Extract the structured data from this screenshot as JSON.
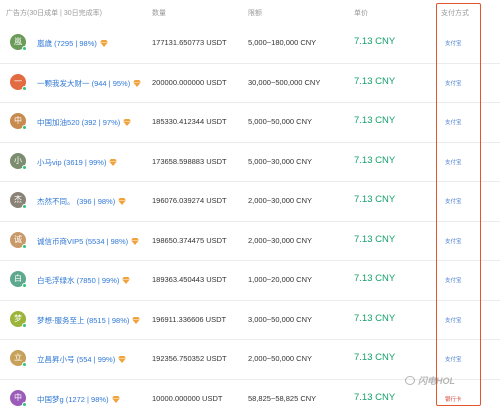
{
  "header": {
    "advertiser": "广告方(30日成单 | 30日完成率)",
    "quantity": "数量",
    "limit": "限额",
    "price": "单价",
    "payment": "支付方式"
  },
  "rows": [
    {
      "avatar": "嵐",
      "avatar_color": "#6b9b59",
      "name": "嵐歳 (7295 | 98%)",
      "qty": "177131.650773 USDT",
      "limit": "5,000~180,000 CNY",
      "price": "7.13 CNY",
      "pay": "支付宝"
    },
    {
      "avatar": "一",
      "avatar_color": "#e26b42",
      "name": "一颗我发大财一 (944 | 95%)",
      "qty": "200000.000000 USDT",
      "limit": "30,000~500,000 CNY",
      "price": "7.13 CNY",
      "pay": "支付宝"
    },
    {
      "avatar": "中",
      "avatar_color": "#c78a4f",
      "name": "中国加油520 (392 | 97%)",
      "qty": "185330.412344 USDT",
      "limit": "5,000~50,000 CNY",
      "price": "7.13 CNY",
      "pay": "支付宝"
    },
    {
      "avatar": "小",
      "avatar_color": "#7c8c6e",
      "name": "小马vip (3619 | 99%)",
      "qty": "173658.598883 USDT",
      "limit": "5,000~30,000 CNY",
      "price": "7.13 CNY",
      "pay": "支付宝"
    },
    {
      "avatar": "杰",
      "avatar_color": "#8a8276",
      "name": "杰然不同。 (396 | 98%)",
      "qty": "196076.039274 USDT",
      "limit": "2,000~30,000 CNY",
      "price": "7.13 CNY",
      "pay": "支付宝"
    },
    {
      "avatar": "诚",
      "avatar_color": "#c89a6a",
      "name": "诚信币商VIP5 (5534 | 98%)",
      "qty": "198650.374475 USDT",
      "limit": "2,000~30,000 CNY",
      "price": "7.13 CNY",
      "pay": "支付宝"
    },
    {
      "avatar": "白",
      "avatar_color": "#5ea88e",
      "name": "白毛浮绿水 (7850 | 99%)",
      "qty": "189363.450443 USDT",
      "limit": "1,000~20,000 CNY",
      "price": "7.13 CNY",
      "pay": "支付宝"
    },
    {
      "avatar": "梦",
      "avatar_color": "#9bb43a",
      "name": "梦想-服务至上 (8515 | 98%)",
      "qty": "196911.336606 USDT",
      "limit": "3,000~50,000 CNY",
      "price": "7.13 CNY",
      "pay": "支付宝"
    },
    {
      "avatar": "立",
      "avatar_color": "#c7a15a",
      "name": "立昌昇小号 (554 | 99%)",
      "qty": "192356.750352 USDT",
      "limit": "2,000~50,000 CNY",
      "price": "7.13 CNY",
      "pay": "支付宝"
    },
    {
      "avatar": "中",
      "avatar_color": "#9b5bb8",
      "name": "中国梦g (1272 | 98%)",
      "qty": "10000.000000 USDT",
      "limit": "58,825~58,825 CNY",
      "price": "7.13 CNY",
      "pay": "银行卡",
      "pay_red": true
    }
  ],
  "colors": {
    "link": "#2f78d6",
    "price": "#15a06a",
    "highlight_border": "#e4552f",
    "badge": "#f0a23b"
  },
  "watermark": "闪电HOL",
  "icons": {
    "badge": "diamond-badge-icon",
    "watermark": "wechat-icon"
  }
}
